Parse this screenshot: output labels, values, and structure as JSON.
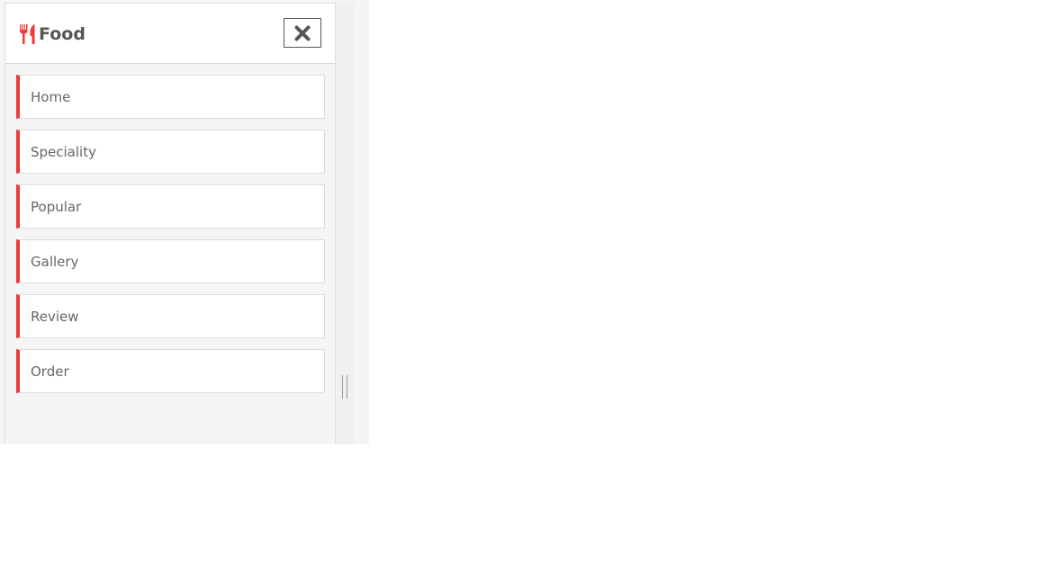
{
  "brand": {
    "icon": "utensils-icon",
    "name": "Food",
    "accent_color": "#f03a3a"
  },
  "close_button": {
    "icon": "close-x-icon"
  },
  "nav": {
    "items": [
      {
        "label": "Home"
      },
      {
        "label": "Speciality"
      },
      {
        "label": "Popular"
      },
      {
        "label": "Gallery"
      },
      {
        "label": "Review"
      },
      {
        "label": "Order"
      }
    ]
  }
}
